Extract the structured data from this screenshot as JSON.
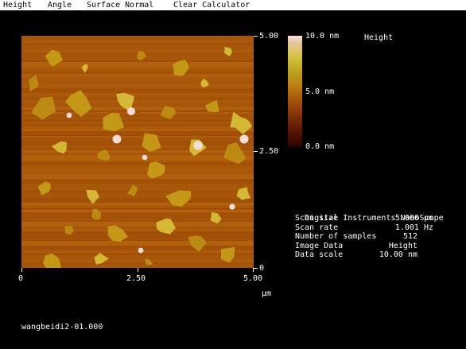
{
  "menu": {
    "items": [
      "Height",
      "Angle",
      "Surface Normal",
      "Clear Calculator"
    ]
  },
  "image_panel": {
    "y_axis": {
      "top": "5.00",
      "mid": "2.50",
      "bottom": "0"
    },
    "x_axis": {
      "left": "0",
      "mid": "2.50",
      "right": "5.00"
    },
    "unit_label": "µm"
  },
  "colorbar": {
    "title": "Height",
    "max_label": "10.0 nm",
    "mid_label": "5.0 nm",
    "min_label": "0.0 nm"
  },
  "info": {
    "title": "Digital Instruments NanoScope",
    "rows": [
      {
        "key": "Scan size",
        "value": "5.000 µm"
      },
      {
        "key": "Scan rate",
        "value": "1.001 Hz"
      },
      {
        "key": "Number of samples",
        "value": "512"
      },
      {
        "key": "Image Data",
        "value": "Height"
      },
      {
        "key": "Data scale",
        "value": "10.00 nm"
      }
    ]
  },
  "filename": "wangbeidi2-01.000",
  "colors": {
    "substrate": "#a9560a",
    "flake": "#c8a018",
    "flake_bright": "#d9c23a",
    "particle": "#f5dcd6"
  }
}
